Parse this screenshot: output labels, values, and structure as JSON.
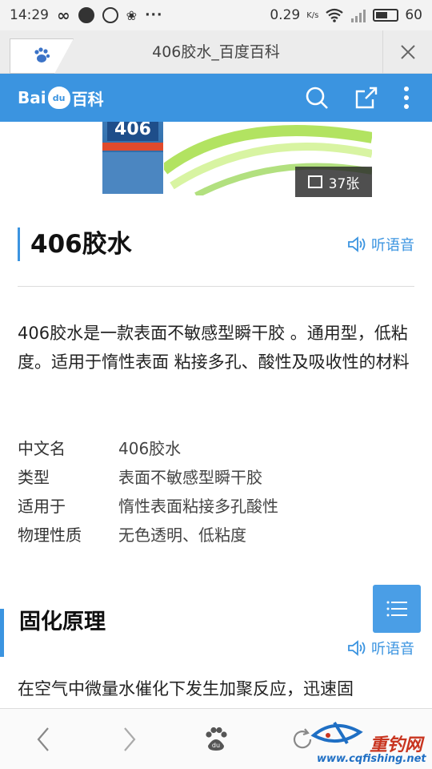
{
  "status_bar": {
    "time": "14:29",
    "speed": "0.29",
    "speed_unit": "K/s",
    "battery": "60",
    "battery_level": 0.6,
    "overflow": "···"
  },
  "browser_tab": {
    "title": "406胶水_百度百科"
  },
  "header": {
    "logo_text_left": "Bai",
    "logo_badge": "du",
    "logo_text_right": "百科",
    "brand_color": "#3b94e0"
  },
  "hero": {
    "bottle_label": "406",
    "image_count": "37张"
  },
  "article": {
    "title": "406胶水",
    "listen_label": "听语音",
    "summary": "406胶水是一款表面不敏感型瞬干胶 。通用型，低粘度。适用于惰性表面 粘接多孔、酸性及吸收性的材料",
    "infobox": [
      {
        "key": "中文名",
        "value": "406胶水"
      },
      {
        "key": "类型",
        "value": "表面不敏感型瞬干胶"
      },
      {
        "key": "适用于",
        "value": "惰性表面粘接多孔酸性"
      },
      {
        "key": "物理性质",
        "value": "无色透明、低粘度"
      }
    ],
    "section_title": "固化原理",
    "section_listen_label": "听语音",
    "section_text": "在空气中微量水催化下发生加聚反应，迅速固"
  },
  "watermark": {
    "brand": "重钓网",
    "url": "www.cqfishing.net"
  }
}
